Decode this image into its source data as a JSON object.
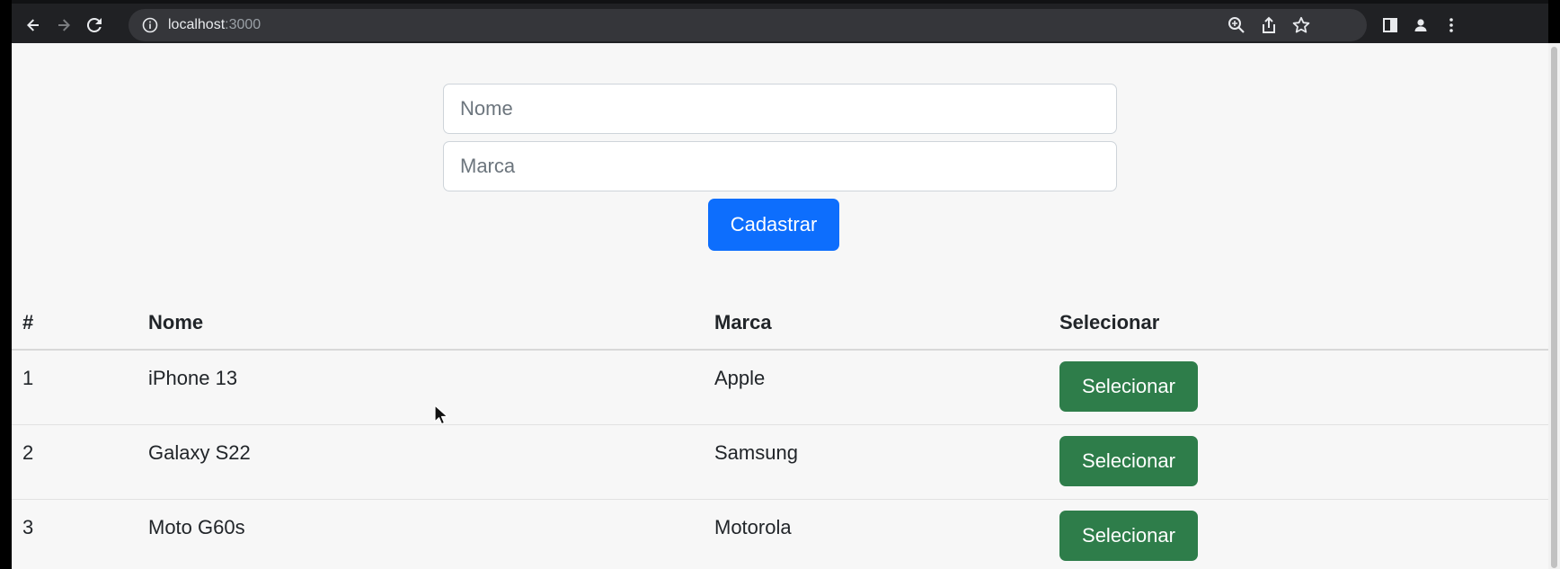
{
  "browser": {
    "url_host": "localhost",
    "url_port": ":3000",
    "icons": {
      "back": "back-arrow-icon",
      "forward": "forward-arrow-icon",
      "reload": "reload-icon",
      "site_info": "info-icon",
      "zoom": "zoom-icon",
      "share": "share-icon",
      "bookmark": "star-icon",
      "side_panel": "side-panel-icon",
      "profile": "profile-icon",
      "menu": "kebab-menu-icon"
    }
  },
  "form": {
    "nome_placeholder": "Nome",
    "marca_placeholder": "Marca",
    "submit_label": "Cadastrar"
  },
  "table": {
    "headers": [
      "#",
      "Nome",
      "Marca",
      "Selecionar"
    ],
    "rows": [
      {
        "id": "1",
        "nome": "iPhone 13",
        "marca": "Apple",
        "action": "Selecionar"
      },
      {
        "id": "2",
        "nome": "Galaxy S22",
        "marca": "Samsung",
        "action": "Selecionar"
      },
      {
        "id": "3",
        "nome": "Moto G60s",
        "marca": "Motorola",
        "action": "Selecionar"
      }
    ]
  },
  "colors": {
    "primary": "#0d6efd",
    "success": "#2e7d4a",
    "toolbar": "#202124",
    "omnibox": "#35363a"
  }
}
